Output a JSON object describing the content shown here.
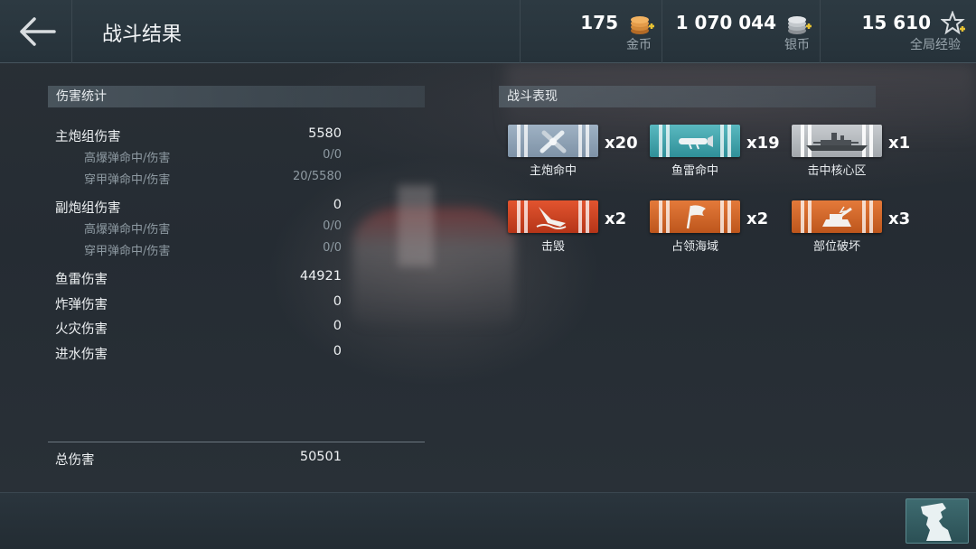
{
  "header": {
    "title": "战斗结果",
    "gold": {
      "value": "175",
      "label": "金币",
      "icon": "gold-coin-stack-icon"
    },
    "silver": {
      "value": "1 070 044",
      "label": "银币",
      "icon": "silver-coin-stack-icon"
    },
    "xp": {
      "value": "15 610",
      "label": "全局经验",
      "icon": "star-plus-icon"
    }
  },
  "damage": {
    "heading": "伤害统计",
    "rows": [
      {
        "name": "主炮组伤害",
        "value": "5580"
      },
      {
        "name": "高爆弹命中/伤害",
        "value": "0/0"
      },
      {
        "name": "穿甲弹命中/伤害",
        "value": "20/5580"
      },
      {
        "name": "副炮组伤害",
        "value": "0"
      },
      {
        "name": "高爆弹命中/伤害",
        "value": "0/0"
      },
      {
        "name": "穿甲弹命中/伤害",
        "value": "0/0"
      },
      {
        "name": "鱼雷伤害",
        "value": "44921"
      },
      {
        "name": "炸弹伤害",
        "value": "0"
      },
      {
        "name": "火灾伤害",
        "value": "0"
      },
      {
        "name": "进水伤害",
        "value": "0"
      }
    ],
    "total": {
      "name": "总伤害",
      "value": "50501"
    }
  },
  "performance": {
    "heading": "战斗表现",
    "medals": [
      {
        "label": "主炮命中",
        "count": "x20",
        "icon": "crossed-shells-icon",
        "color": "#8fa3b6"
      },
      {
        "label": "鱼雷命中",
        "count": "x19",
        "icon": "torpedo-icon",
        "color": "#45a6ad"
      },
      {
        "label": "击中核心区",
        "count": "x1",
        "icon": "warship-icon",
        "color": "#b8bcc0"
      },
      {
        "label": "击毁",
        "count": "x2",
        "icon": "sinking-ship-icon",
        "color": "#cc4422"
      },
      {
        "label": "占领海域",
        "count": "x2",
        "icon": "flag-icon",
        "color": "#d2682b"
      },
      {
        "label": "部位破坏",
        "count": "x3",
        "icon": "damaged-turret-icon",
        "color": "#d2682b"
      }
    ]
  }
}
